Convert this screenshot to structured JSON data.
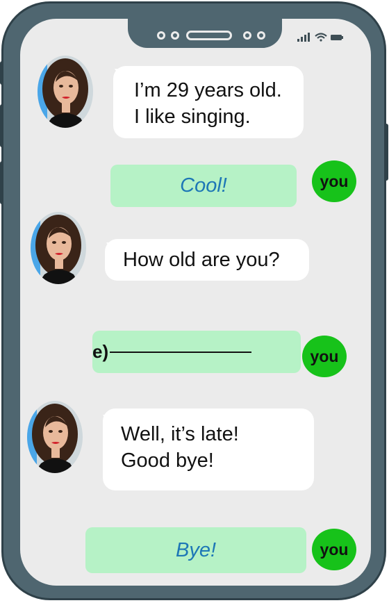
{
  "messages": [
    {
      "from": "friend",
      "lines": [
        "I’m 29 years old.",
        "I like singing."
      ]
    },
    {
      "from": "you",
      "text": "Cool!",
      "badge": "you"
    },
    {
      "from": "friend",
      "lines": [
        "How old are you?"
      ]
    },
    {
      "from": "you",
      "prompt": "e)",
      "answer": "",
      "badge": "you"
    },
    {
      "from": "friend",
      "lines": [
        "Well, it’s late!",
        "Good bye!"
      ]
    },
    {
      "from": "you",
      "text": "Bye!",
      "badge": "you"
    }
  ],
  "colors": {
    "phone_frame": "#4f6670",
    "screen": "#ebebeb",
    "friend_bubble": "#ffffff",
    "you_bubble": "#b6f2c6",
    "you_text": "#1d77b6",
    "you_badge": "#17c21a"
  },
  "icons": [
    "signal-icon",
    "wifi-icon",
    "battery-icon"
  ]
}
